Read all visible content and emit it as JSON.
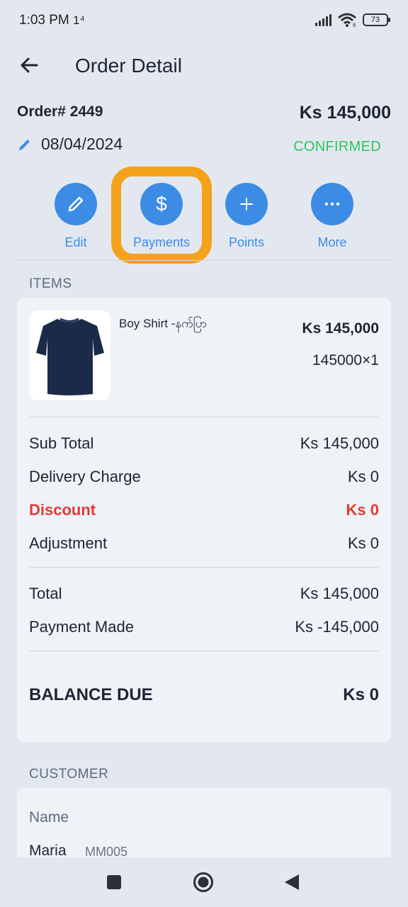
{
  "status_bar": {
    "time": "1:03 PM",
    "network": "1⁴",
    "wifi": "6",
    "battery": "73"
  },
  "header": {
    "title": "Order Detail"
  },
  "order": {
    "number": "Order# 2449",
    "total": "Ks 145,000",
    "date": "08/04/2024",
    "status": "CONFIRMED",
    "status_color": "#2ec45c"
  },
  "actions": [
    {
      "label": "Edit",
      "icon": "pencil-icon"
    },
    {
      "label": "Payments",
      "icon": "dollar-icon"
    },
    {
      "label": "Points",
      "icon": "plus-icon"
    },
    {
      "label": "More",
      "icon": "more-icon"
    }
  ],
  "accent_color": "#3c8ce6",
  "highlight_color": "#f4a21a",
  "items_section": {
    "label": "ITEMS",
    "items": [
      {
        "name": "Boy Shirt -နက်ပြာ",
        "price": "Ks 145,000",
        "qty": "145000×1",
        "image": "navy-tshirt"
      }
    ],
    "summary": {
      "sub_total": {
        "label": "Sub Total",
        "value": "Ks 145,000"
      },
      "delivery": {
        "label": "Delivery Charge",
        "value": "Ks 0"
      },
      "discount": {
        "label": "Discount",
        "value": "Ks 0"
      },
      "adjustment": {
        "label": "Adjustment",
        "value": "Ks 0"
      },
      "total": {
        "label": "Total",
        "value": "Ks 145,000"
      },
      "payment_made": {
        "label": "Payment Made",
        "value": "Ks -145,000"
      },
      "balance_due": {
        "label": "BALANCE DUE",
        "value": "Ks 0"
      }
    }
  },
  "customer_section": {
    "label": "CUSTOMER",
    "name_label": "Name",
    "name": "Maria",
    "code": "MM005"
  },
  "nav": [
    "recents-button",
    "home-button",
    "back-button"
  ]
}
